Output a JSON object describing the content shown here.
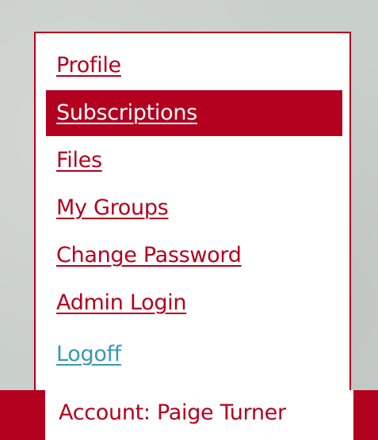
{
  "menu": {
    "items": [
      {
        "label": "Profile"
      },
      {
        "label": "Subscriptions"
      },
      {
        "label": "Files"
      },
      {
        "label": "My Groups"
      },
      {
        "label": "Change Password"
      },
      {
        "label": "Admin Login"
      },
      {
        "label": "Logoff"
      }
    ],
    "active_item": "Subscriptions"
  },
  "account": {
    "label": "Account: Paige Turner"
  },
  "colors": {
    "accent": "#b3001e",
    "link_logoff": "#3798b2",
    "background": "#c9cfcb",
    "panel": "#ffffff"
  }
}
